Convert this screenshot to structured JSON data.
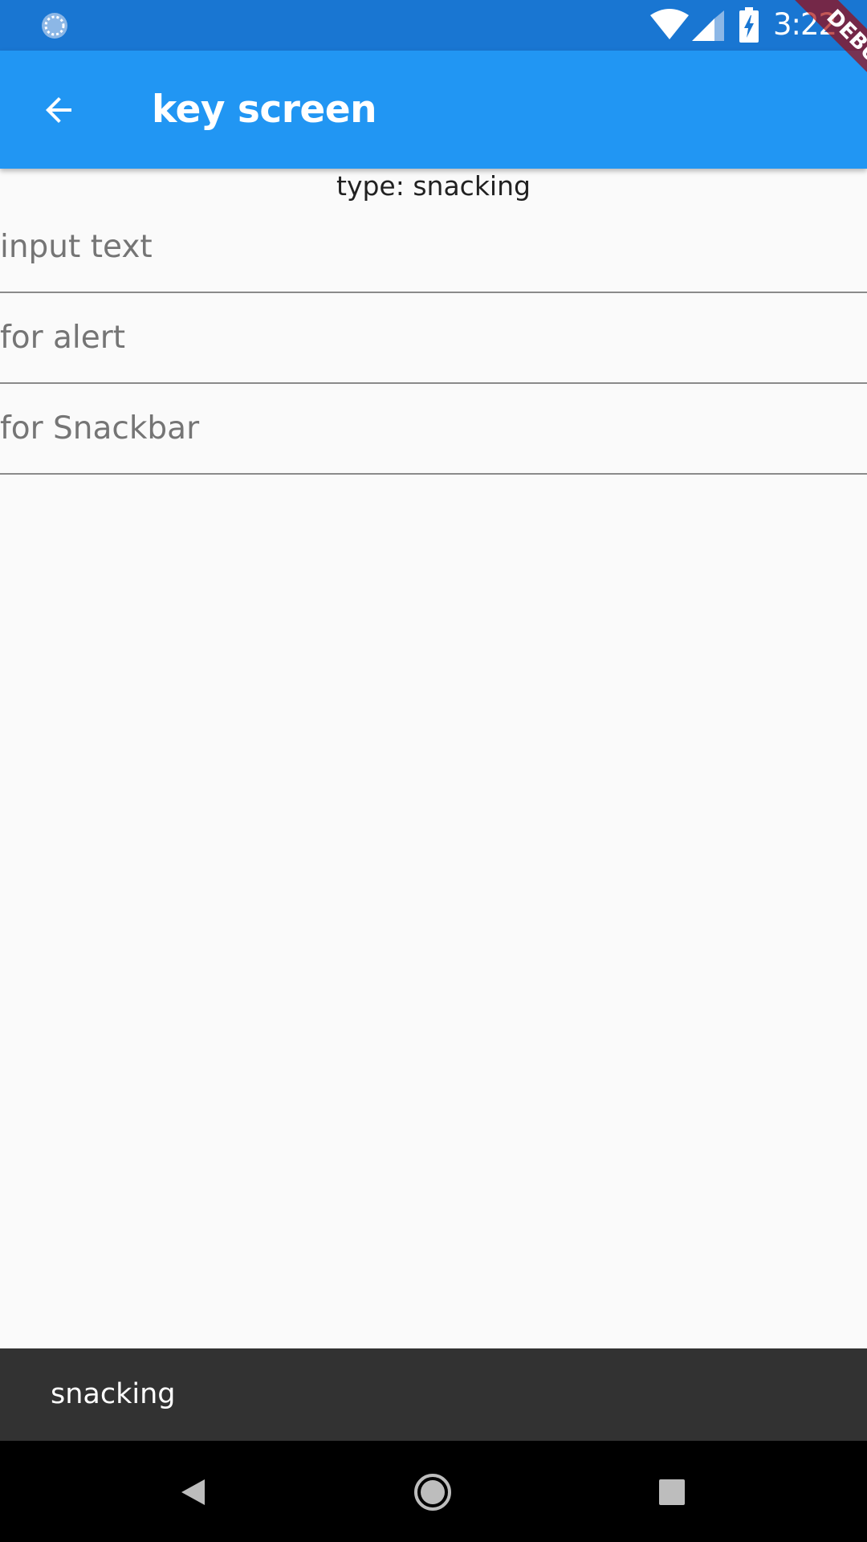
{
  "status_bar": {
    "time": "3:22",
    "icons": [
      "sync-icon",
      "wifi-icon",
      "signal-icon",
      "battery-charging-icon"
    ],
    "background_color": "#1976D2"
  },
  "app_bar": {
    "title": "key screen",
    "back_icon": "arrow-back-icon",
    "background_color": "#2196F3"
  },
  "debug_banner": {
    "label": "DEBUG"
  },
  "content": {
    "type_label": "type: snacking",
    "fields": [
      {
        "placeholder": "input text",
        "value": ""
      },
      {
        "placeholder": "for alert",
        "value": ""
      },
      {
        "placeholder": "for Snackbar",
        "value": ""
      }
    ]
  },
  "snackbar": {
    "text": "snacking",
    "background_color": "#323232"
  },
  "nav_bar": {
    "icons": [
      "nav-back-icon",
      "nav-home-icon",
      "nav-recents-icon"
    ]
  }
}
